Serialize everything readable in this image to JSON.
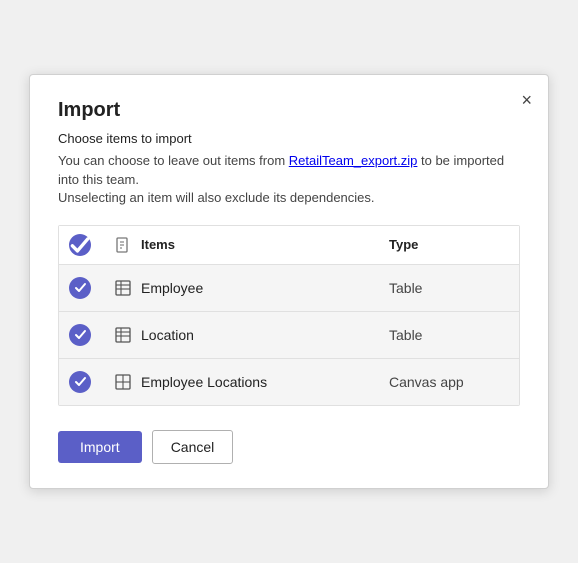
{
  "dialog": {
    "title": "Import",
    "subtitle": "Choose items to import",
    "description_part1": "You can choose to leave out items from ",
    "description_link": "RetailTeam_export.zip",
    "description_part2": " to be imported into this team.",
    "note": "Unselecting an item will also exclude its dependencies.",
    "close_label": "×"
  },
  "table": {
    "columns": {
      "check": "",
      "icon": "",
      "items": "Items",
      "type": "Type"
    },
    "rows": [
      {
        "name": "Employee",
        "type": "Table",
        "icon": "table-icon",
        "checked": true
      },
      {
        "name": "Location",
        "type": "Table",
        "icon": "table-icon",
        "checked": true
      },
      {
        "name": "Employee Locations",
        "type": "Canvas app",
        "icon": "canvas-icon",
        "checked": true
      }
    ]
  },
  "footer": {
    "import_label": "Import",
    "cancel_label": "Cancel"
  }
}
